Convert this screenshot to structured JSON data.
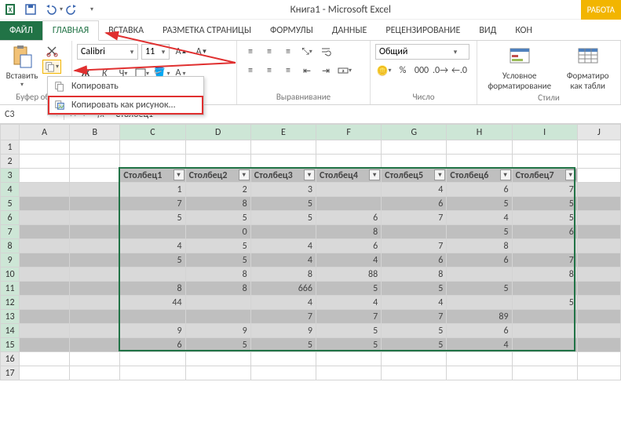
{
  "app": {
    "title": "Книга1 - Microsoft Excel",
    "right_label": "РАБОТА"
  },
  "qat": {
    "save_tip": "Сохранить",
    "undo_tip": "Отменить",
    "redo_tip": "Повторить"
  },
  "tabs": {
    "file": "ФАЙЛ",
    "home": "ГЛАВНАЯ",
    "insert": "ВСТАВКА",
    "page": "РАЗМЕТКА СТРАНИЦЫ",
    "formulas": "ФОРМУЛЫ",
    "data": "ДАННЫЕ",
    "review": "РЕЦЕНЗИРОВАНИЕ",
    "view": "ВИД",
    "design": "КОН"
  },
  "ribbon": {
    "clipboard": {
      "paste": "Вставить",
      "group": "Буфер обм"
    },
    "font": {
      "name": "Calibri",
      "size": "11",
      "group": ""
    },
    "align": {
      "group": "Выравнивание"
    },
    "number": {
      "format": "Общий",
      "group": "Число"
    },
    "styles": {
      "cond": "Условное форматирование",
      "table": "Форматиро как табли",
      "group": "Стили"
    }
  },
  "copy_menu": {
    "copy": "Копировать",
    "copy_as_pic": "Копировать как рисунок..."
  },
  "namebox": {
    "ref": "C3"
  },
  "formula": {
    "value": "Столбец1"
  },
  "grid": {
    "columns": [
      "A",
      "B",
      "C",
      "D",
      "E",
      "F",
      "G",
      "H",
      "I",
      "J"
    ],
    "rows": [
      "1",
      "2",
      "3",
      "4",
      "5",
      "6",
      "7",
      "8",
      "9",
      "10",
      "11",
      "12",
      "13",
      "14",
      "15",
      "16",
      "17"
    ],
    "selected_cols": [
      "C",
      "D",
      "E",
      "F",
      "G",
      "H",
      "I"
    ],
    "selected_rows": [
      "3",
      "4",
      "5",
      "6",
      "7",
      "8",
      "9",
      "10",
      "11",
      "12",
      "13",
      "14",
      "15"
    ]
  },
  "table": {
    "headers": [
      "Столбец1",
      "Столбец2",
      "Столбец3",
      "Столбец4",
      "Столбец5",
      "Столбец6",
      "Столбец7"
    ],
    "rows": [
      [
        "1",
        "2",
        "3",
        "",
        "4",
        "6",
        "7"
      ],
      [
        "7",
        "8",
        "5",
        "",
        "6",
        "5",
        "5"
      ],
      [
        "5",
        "5",
        "5",
        "6",
        "7",
        "4",
        "5"
      ],
      [
        "",
        "0",
        "",
        "8",
        "",
        "5",
        "6"
      ],
      [
        "4",
        "5",
        "4",
        "6",
        "7",
        "8",
        ""
      ],
      [
        "5",
        "5",
        "4",
        "4",
        "6",
        "6",
        "7"
      ],
      [
        "",
        "8",
        "8",
        "88",
        "8",
        "",
        "8"
      ],
      [
        "8",
        "8",
        "666",
        "5",
        "5",
        "5",
        ""
      ],
      [
        "44",
        "",
        "4",
        "4",
        "4",
        "",
        "5"
      ],
      [
        "",
        "",
        "7",
        "7",
        "7",
        "89",
        ""
      ],
      [
        "9",
        "9",
        "9",
        "5",
        "5",
        "6",
        ""
      ],
      [
        "6",
        "5",
        "5",
        "5",
        "5",
        "4",
        ""
      ]
    ]
  },
  "chart_data": {
    "type": "table",
    "title": "Книга1 - Microsoft Excel",
    "columns": [
      "Столбец1",
      "Столбец2",
      "Столбец3",
      "Столбец4",
      "Столбец5",
      "Столбец6",
      "Столбец7"
    ],
    "data": [
      [
        1,
        2,
        3,
        null,
        4,
        6,
        7
      ],
      [
        7,
        8,
        5,
        null,
        6,
        5,
        5
      ],
      [
        5,
        5,
        5,
        6,
        7,
        4,
        5
      ],
      [
        null,
        0,
        null,
        8,
        null,
        5,
        6
      ],
      [
        4,
        5,
        4,
        6,
        7,
        8,
        null
      ],
      [
        5,
        5,
        4,
        4,
        6,
        6,
        7
      ],
      [
        null,
        8,
        8,
        88,
        8,
        null,
        8
      ],
      [
        8,
        8,
        666,
        5,
        5,
        5,
        null
      ],
      [
        44,
        null,
        4,
        4,
        4,
        null,
        5
      ],
      [
        null,
        null,
        7,
        7,
        7,
        89,
        null
      ],
      [
        9,
        9,
        9,
        5,
        5,
        6,
        null
      ],
      [
        6,
        5,
        5,
        5,
        5,
        4,
        null
      ]
    ]
  },
  "colors": {
    "accent": "#217346",
    "annotate": "#e03030"
  }
}
